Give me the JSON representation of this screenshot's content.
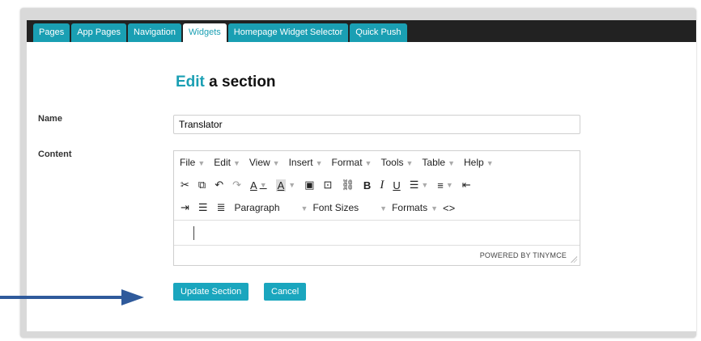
{
  "tabs": [
    {
      "label": "Pages"
    },
    {
      "label": "App Pages"
    },
    {
      "label": "Navigation"
    },
    {
      "label": "Widgets",
      "active": true
    },
    {
      "label": "Homepage Widget Selector"
    },
    {
      "label": "Quick Push"
    }
  ],
  "heading": {
    "accent": "Edit",
    "rest": " a section"
  },
  "form": {
    "name_label": "Name",
    "name_value": "Translator",
    "content_label": "Content"
  },
  "editor": {
    "menu": [
      "File",
      "Edit",
      "View",
      "Insert",
      "Format",
      "Tools",
      "Table",
      "Help"
    ],
    "toolbar": {
      "bold": "B",
      "italic": "I",
      "underline": "U",
      "paragraph": "Paragraph",
      "font_sizes": "Font Sizes",
      "formats": "Formats",
      "code": "<>"
    },
    "powered_by": "POWERED BY TINYMCE"
  },
  "buttons": {
    "update": "Update Section",
    "cancel": "Cancel"
  },
  "colors": {
    "accent": "#1a9fb3",
    "button": "#1aa6be",
    "topbar": "#222222",
    "arrow": "#2f5a9b"
  }
}
